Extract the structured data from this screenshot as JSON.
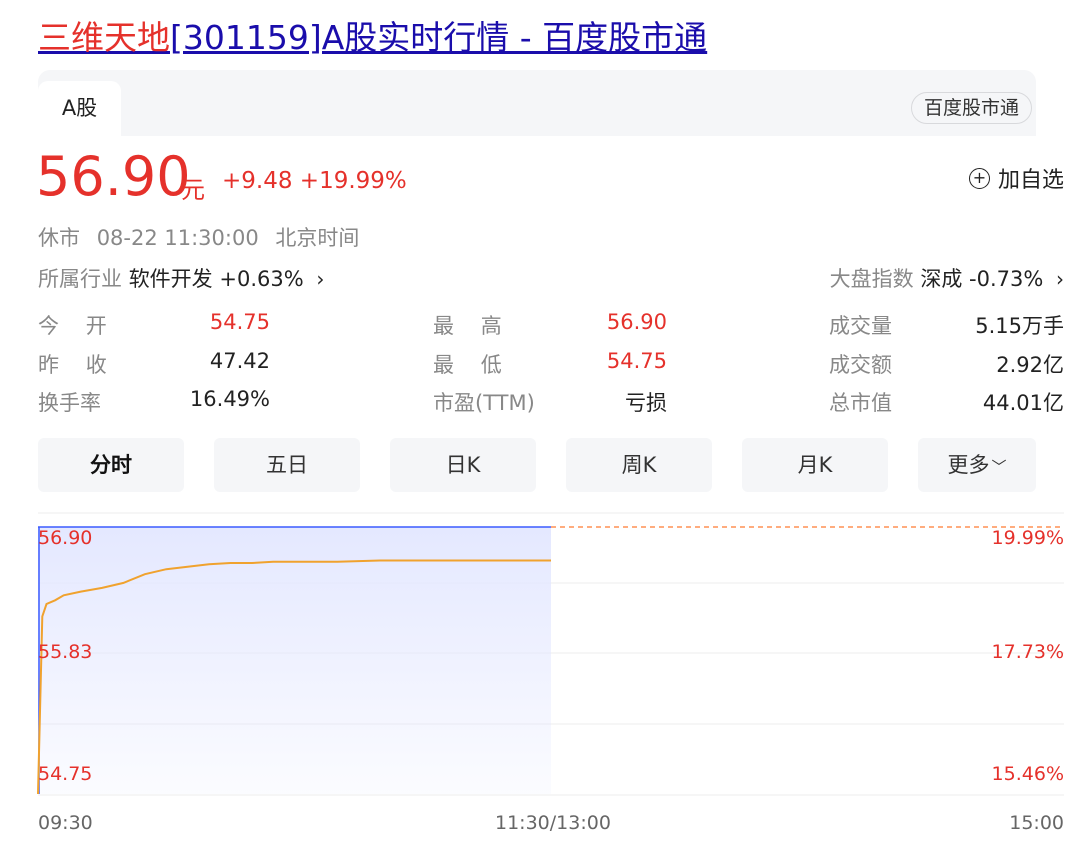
{
  "header": {
    "title_highlight": "三维天地",
    "title_rest": "[301159]A股实时行情 - 百度股市通"
  },
  "tabs": {
    "active": "A股",
    "source": "百度股市通"
  },
  "quote": {
    "price": "56.90",
    "unit": "元",
    "change": "+9.48 +19.99%",
    "watch_label": "加自选",
    "status": "休市",
    "time": "08-22 11:30:00",
    "timezone": "北京时间"
  },
  "industry": {
    "label": "所属行业",
    "name": "软件开发",
    "change": "+0.63%"
  },
  "market": {
    "label": "大盘指数",
    "name": "深成",
    "change": "-0.73%"
  },
  "stats": [
    {
      "label": "今    开",
      "value": "54.75",
      "color": "#e5312b"
    },
    {
      "label": "最    高",
      "value": "56.90",
      "color": "#e5312b"
    },
    {
      "label": "成交量",
      "value": "5.15万手",
      "color": "#222222"
    },
    {
      "label": "昨    收",
      "value": "47.42",
      "color": "#222222"
    },
    {
      "label": "最    低",
      "value": "54.75",
      "color": "#e5312b"
    },
    {
      "label": "成交额",
      "value": "2.92亿",
      "color": "#222222"
    },
    {
      "label": "换手率",
      "value": "16.49%",
      "color": "#222222"
    },
    {
      "label": "市盈(TTM)",
      "value": "亏损",
      "color": "#222222"
    },
    {
      "label": "总市值",
      "value": "44.01亿",
      "color": "#222222"
    }
  ],
  "chart_tabs": [
    "分时",
    "五日",
    "日K",
    "周K",
    "月K",
    "更多"
  ],
  "chart_data": {
    "type": "line",
    "y_left_ticks": [
      "56.90",
      "55.83",
      "54.75"
    ],
    "y_right_ticks": [
      "19.99%",
      "17.73%",
      "15.46%"
    ],
    "x_ticks": [
      "09:30",
      "11:30/13:00",
      "15:00"
    ],
    "ylim": [
      54.75,
      56.9
    ],
    "session_minutes": 240,
    "limit_up": 56.9,
    "series": [
      {
        "minutes": [
          0,
          1,
          2,
          4,
          6,
          10,
          15,
          20,
          25,
          30,
          35,
          40,
          45,
          50,
          55,
          60,
          70,
          80,
          90,
          100,
          110,
          120
        ],
        "values": [
          54.75,
          56.18,
          56.28,
          56.31,
          56.35,
          56.38,
          56.41,
          56.45,
          56.52,
          56.56,
          56.58,
          56.6,
          56.61,
          56.61,
          56.62,
          56.62,
          56.62,
          56.63,
          56.63,
          56.63,
          56.63,
          56.63
        ]
      }
    ],
    "colors": {
      "line": "#f0a22e",
      "limit": "#ff7a30",
      "fill": "#e4e8ff",
      "open_spike": "#3b5bff"
    }
  },
  "colors": {
    "up": "#e5312b",
    "link": "#1a0dab"
  }
}
